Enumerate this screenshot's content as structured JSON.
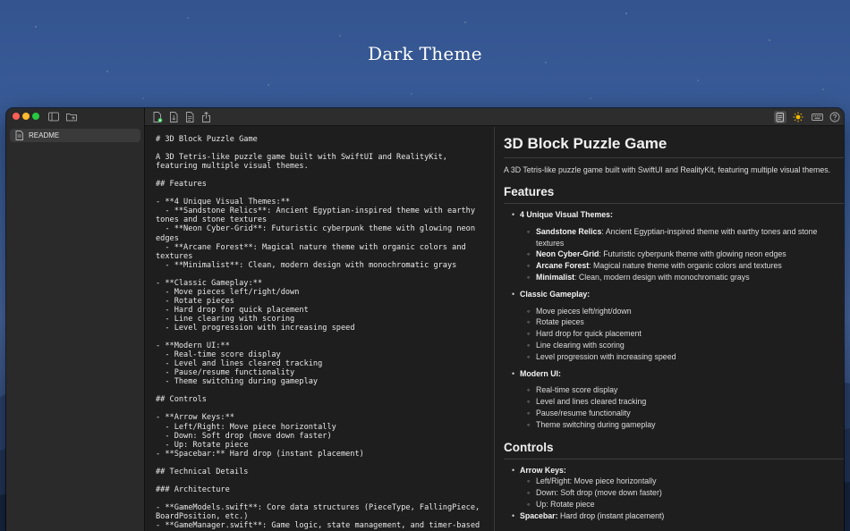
{
  "hero": {
    "title": "Dark Theme"
  },
  "sidebar": {
    "files": [
      {
        "label": "README"
      }
    ]
  },
  "editor": {
    "markdown": "# 3D Block Puzzle Game\n\nA 3D Tetris-like puzzle game built with SwiftUI and RealityKit, featuring multiple visual themes.\n\n## Features\n\n- **4 Unique Visual Themes:**\n  - **Sandstone Relics**: Ancient Egyptian-inspired theme with earthy tones and stone textures\n  - **Neon Cyber-Grid**: Futuristic cyberpunk theme with glowing neon edges\n  - **Arcane Forest**: Magical nature theme with organic colors and textures\n  - **Minimalist**: Clean, modern design with monochromatic grays\n\n- **Classic Gameplay:**\n  - Move pieces left/right/down\n  - Rotate pieces\n  - Hard drop for quick placement\n  - Line clearing with scoring\n  - Level progression with increasing speed\n\n- **Modern UI:**\n  - Real-time score display\n  - Level and lines cleared tracking\n  - Pause/resume functionality\n  - Theme switching during gameplay\n\n## Controls\n\n- **Arrow Keys:**\n  - Left/Right: Move piece horizontally\n  - Down: Soft drop (move down faster)\n  - Up: Rotate piece\n- **Spacebar:** Hard drop (instant placement)\n\n## Technical Details\n\n### Architecture\n\n- **GameModels.swift**: Core data structures (PieceType, FallingPiece, BoardPosition, etc.)\n- **GameManager.swift**: Game logic, state management, and timer-based"
  },
  "preview": {
    "title": "3D Block Puzzle Game",
    "intro": "A 3D Tetris-like puzzle game built with SwiftUI and RealityKit, featuring multiple visual themes.",
    "features_heading": "Features",
    "themes_label": "4 Unique Visual Themes:",
    "themes": [
      {
        "name": "Sandstone Relics",
        "desc": ": Ancient Egyptian-inspired theme with earthy tones and stone textures"
      },
      {
        "name": "Neon Cyber-Grid",
        "desc": ": Futuristic cyberpunk theme with glowing neon edges"
      },
      {
        "name": "Arcane Forest",
        "desc": ": Magical nature theme with organic colors and textures"
      },
      {
        "name": "Minimalist",
        "desc": ": Clean, modern design with monochromatic grays"
      }
    ],
    "gameplay_label": "Classic Gameplay:",
    "gameplay": [
      "Move pieces left/right/down",
      "Rotate pieces",
      "Hard drop for quick placement",
      "Line clearing with scoring",
      "Level progression with increasing speed"
    ],
    "ui_label": "Modern UI:",
    "ui": [
      "Real-time score display",
      "Level and lines cleared tracking",
      "Pause/resume functionality",
      "Theme switching during gameplay"
    ],
    "controls_heading": "Controls",
    "arrow_label": "Arrow Keys:",
    "arrows": [
      "Left/Right: Move piece horizontally",
      "Down: Soft drop (move down faster)",
      "Up: Rotate piece"
    ],
    "spacebar_label": "Spacebar:",
    "spacebar_desc": " Hard drop (instant placement)"
  },
  "toolbar": {
    "icons": [
      "new-file-icon",
      "save-file-icon",
      "document-icon",
      "share-icon",
      "preview-toggle-icon",
      "theme-sun-icon",
      "keyboard-icon",
      "help-icon"
    ],
    "accent_color": "#f5b800"
  }
}
